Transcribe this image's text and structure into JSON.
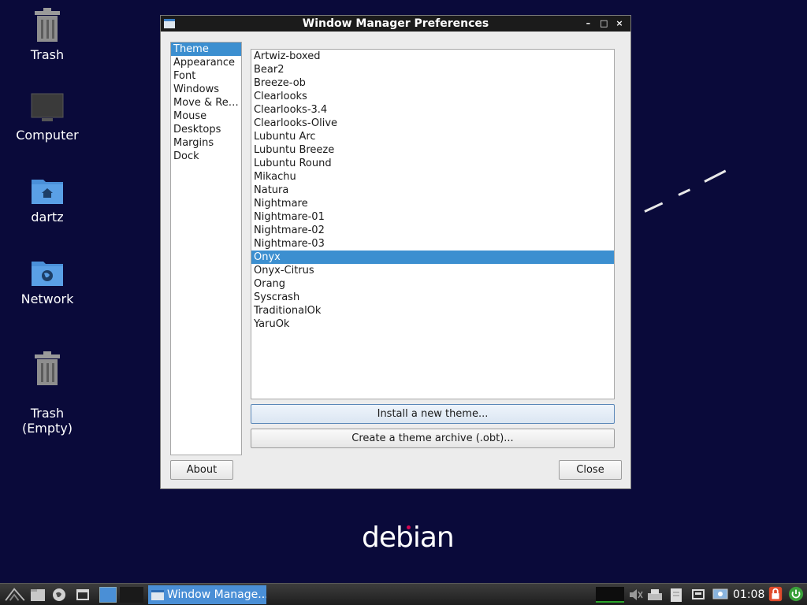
{
  "desktop": {
    "icons": [
      {
        "label": "Trash"
      },
      {
        "label": "Computer"
      },
      {
        "label": "dartz"
      },
      {
        "label": "Network"
      },
      {
        "label": "Trash\n(Empty)"
      }
    ],
    "wallpaper_text": "debian"
  },
  "window": {
    "title": "Window Manager Preferences",
    "controls": {
      "minimize": "–",
      "maximize": "□",
      "close": "×"
    },
    "sidebar": {
      "items": [
        "Theme",
        "Appearance",
        "Font",
        "Windows",
        "Move & Re…",
        "Mouse",
        "Desktops",
        "Margins",
        "Dock"
      ],
      "selected": "Theme"
    },
    "themes": {
      "items": [
        "Artwiz-boxed",
        "Bear2",
        "Breeze-ob",
        "Clearlooks",
        "Clearlooks-3.4",
        "Clearlooks-Olive",
        "Lubuntu Arc",
        "Lubuntu Breeze",
        "Lubuntu Round",
        "Mikachu",
        "Natura",
        "Nightmare",
        "Nightmare-01",
        "Nightmare-02",
        "Nightmare-03",
        "Onyx",
        "Onyx-Citrus",
        "Orang",
        "Syscrash",
        "TraditionalOk",
        "YaruOk"
      ],
      "selected": "Onyx"
    },
    "buttons": {
      "install": "Install a new theme...",
      "archive": "Create a theme archive (.obt)...",
      "about": "About",
      "close": "Close"
    }
  },
  "taskbar": {
    "task_label": "Window Manage...",
    "clock": "01:08"
  },
  "colors": {
    "desktop_bg": "#0a0a3a",
    "selection": "#3c8fd0",
    "folder_blue": "#4a90d9"
  }
}
